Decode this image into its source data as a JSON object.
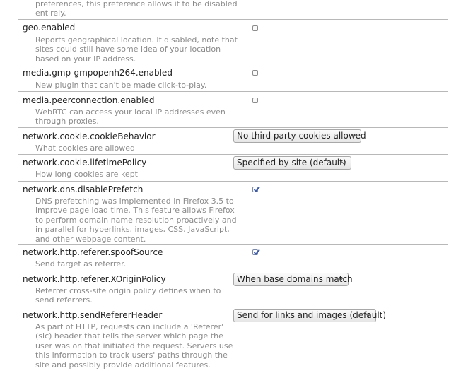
{
  "prefs": [
    {
      "desc": "preferences, this preference allows it to be disabled entirely."
    },
    {
      "name": "geo.enabled",
      "desc": "Reports geographical location. If disabled, note that sites could still have some idea of your location based on your IP address.",
      "checked": false
    },
    {
      "name": "media.gmp-gmpopenh264.enabled",
      "desc": "New plugin that can't be made click-to-play.",
      "checked": false
    },
    {
      "name": "media.peerconnection.enabled",
      "desc": "WebRTC can access your local IP addresses even through proxies.",
      "checked": false
    },
    {
      "name": "network.cookie.cookieBehavior",
      "desc": "What cookies are allowed",
      "value": "No third party cookies allowed"
    },
    {
      "name": "network.cookie.lifetimePolicy",
      "desc": "How long cookies are kept",
      "value": "Specified by site (default)"
    },
    {
      "name": "network.dns.disablePrefetch",
      "desc": "DNS prefetching was implemented in Firefox 3.5 to improve page load time. This feature allows Firefox to perform domain name resolution proactively and in parallel for hyperlinks, images, CSS, JavaScript, and other webpage content.",
      "checked": true
    },
    {
      "name": "network.http.referer.spoofSource",
      "desc": "Send target as referrer.",
      "checked": true
    },
    {
      "name": "network.http.referer.XOriginPolicy",
      "desc": "Referrer cross-site origin policy defines when to send referrers.",
      "value": "When base domains match"
    },
    {
      "name": "network.http.sendRefererHeader",
      "desc": "As part of HTTP, requests can include a 'Referer' (sic) header that tells the server which page the user was on that initiated the request. Servers use this information to track users' paths through the site and possibly provide additional features.",
      "value": "Send for links and images (default)"
    }
  ]
}
